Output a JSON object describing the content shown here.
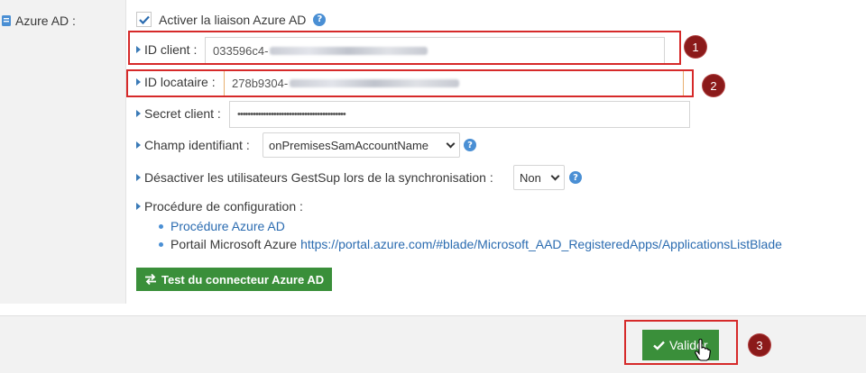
{
  "section": {
    "label": "Azure AD :"
  },
  "enable": {
    "label": "Activer la liaison Azure AD",
    "checked": true
  },
  "client_id": {
    "label": "ID client :",
    "value_prefix": "033596c4-"
  },
  "tenant_id": {
    "label": "ID locataire :",
    "value_prefix": "278b9304-"
  },
  "secret": {
    "label": "Secret client :",
    "value": "••••••••••••••••••••••••••••••••••••••••••"
  },
  "identifier": {
    "label": "Champ identifiant :",
    "selected": "onPremisesSamAccountName"
  },
  "disable_users": {
    "label": "Désactiver les utilisateurs GestSup lors de la synchronisation :",
    "selected": "Non"
  },
  "procedure": {
    "label": "Procédure de configuration :",
    "items": [
      {
        "text": "Procédure Azure AD",
        "link": ""
      },
      {
        "text": "Portail Microsoft Azure",
        "link": "https://portal.azure.com/#blade/Microsoft_AAD_RegisteredApps/ApplicationsListBlade"
      }
    ]
  },
  "test_button": {
    "label": "Test du connecteur Azure AD"
  },
  "validate_button": {
    "label": "Valider"
  },
  "annotations": [
    "1",
    "2",
    "3"
  ],
  "colors": {
    "accent": "#3a7ab7",
    "success": "#3a8f3a",
    "annotation_border": "#d62a2a",
    "badge": "#8b1a1a"
  }
}
